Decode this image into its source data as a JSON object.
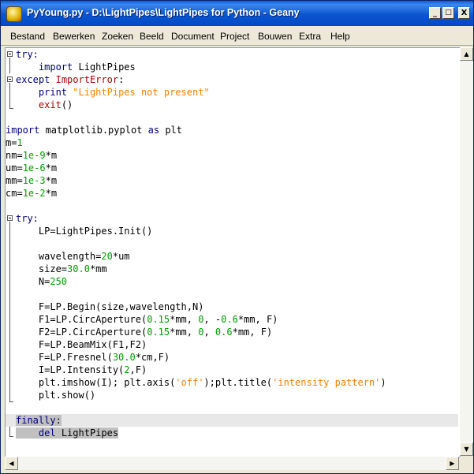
{
  "window": {
    "title": "PyYoung.py - D:\\LightPipes\\LightPipes for Python - Geany",
    "controls": {
      "minimize": "_",
      "maximize": "□",
      "close": "X"
    }
  },
  "menu": [
    "Bestand",
    "Bewerken",
    "Zoeken",
    "Beeld",
    "Document",
    "Project",
    "Bouwen",
    "Extra",
    "Help"
  ],
  "code": {
    "l1_try": "try:",
    "l2_import": "import",
    "l2_rest": " LightPipes",
    "l3_except": "except",
    "l3_exc": "ImportError",
    "l3_colon": ":",
    "l4_print": "print",
    "l4_str": "\"LightPipes not present\"",
    "l5_exit": "exit",
    "l5_paren": "()",
    "l7_import": "import",
    "l7_mid": " matplotlib.pyplot ",
    "l7_as": "as",
    "l7_plt": " plt",
    "l8_a": "m=",
    "l8_b": "1",
    "l9_a": "nm=",
    "l9_b": "1e-9",
    "l9_c": "*m",
    "l10_a": "um=",
    "l10_b": "1e-6",
    "l10_c": "*m",
    "l11_a": "mm=",
    "l11_b": "1e-3",
    "l11_c": "*m",
    "l12_a": "cm=",
    "l12_b": "1e-2",
    "l12_c": "*m",
    "l14_try": "try:",
    "l15": "LP=LightPipes.Init()",
    "l17_a": "wavelength=",
    "l17_b": "20",
    "l17_c": "*um",
    "l18_a": "size=",
    "l18_b": "30.0",
    "l18_c": "*mm",
    "l19_a": "N=",
    "l19_b": "250",
    "l21": "F=LP.Begin(size,wavelength,N)",
    "l22_a": "F1=LP.CircAperture(",
    "l22_b": "0.15",
    "l22_c": "*mm, ",
    "l22_d": "0",
    "l22_e": ", -",
    "l22_f": "0.6",
    "l22_g": "*mm, F)",
    "l23_a": "F2=LP.CircAperture(",
    "l23_b": "0.15",
    "l23_c": "*mm, ",
    "l23_d": "0",
    "l23_e": ", ",
    "l23_f": "0.6",
    "l23_g": "*mm, F)",
    "l24": "F=LP.BeamMix(F1,F2)",
    "l25_a": "F=LP.Fresnel(",
    "l25_b": "30.0",
    "l25_c": "*cm,F)",
    "l26_a": "I=LP.Intensity(",
    "l26_b": "2",
    "l26_c": ",F)",
    "l27_a": "plt.imshow(I); plt.axis(",
    "l27_b": "'off'",
    "l27_c": ");plt.title(",
    "l27_d": "'intensity pattern'",
    "l27_e": ")",
    "l28": "plt.show()",
    "l30_finally": "finally",
    "l30_colon": ":",
    "l31_del": "del",
    "l31_rest": " LightPipes"
  },
  "scroll": {
    "up": "▲",
    "down": "▼",
    "left": "◀",
    "right": "▶"
  }
}
